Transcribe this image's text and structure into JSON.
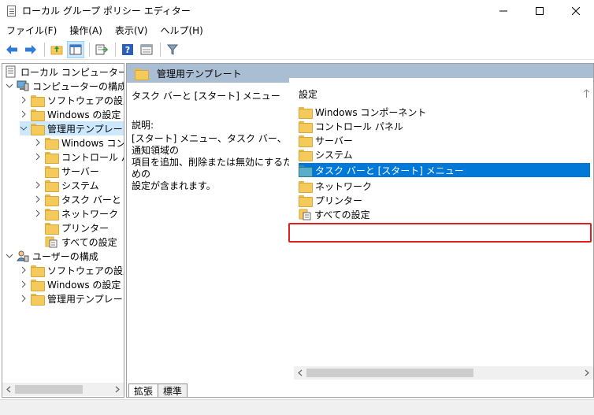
{
  "window": {
    "title": "ローカル グループ ポリシー エディター",
    "minimize_glyph": "—",
    "maximize_glyph": "☐",
    "close_glyph": "✕"
  },
  "menu": {
    "items": [
      "ファイル(F)",
      "操作(A)",
      "表示(V)",
      "ヘルプ(H)"
    ]
  },
  "toolbar": {
    "icons": [
      "back-arrow-icon",
      "forward-arrow-icon",
      "up-folder-icon",
      "show-hide-tree-icon",
      "export-list-icon",
      "help-icon",
      "properties-icon",
      "filter-icon"
    ]
  },
  "tree": {
    "items": [
      {
        "label": "ローカル コンピューター ポリシ",
        "level": 0,
        "icon": "policy-doc-icon"
      },
      {
        "label": "コンピューターの構成",
        "level": 1,
        "icon": "computer-icon",
        "expanded": true
      },
      {
        "label": "ソフトウェアの設定",
        "level": 2,
        "icon": "folder-icon",
        "collapsed": true
      },
      {
        "label": "Windows の設定",
        "level": 2,
        "icon": "folder-icon",
        "collapsed": true
      },
      {
        "label": "管理用テンプレート",
        "level": 2,
        "icon": "folder-icon",
        "expanded": true,
        "selected": true
      },
      {
        "label": "Windows コン",
        "level": 3,
        "icon": "folder-icon",
        "collapsed": true
      },
      {
        "label": "コントロール パネ",
        "level": 3,
        "icon": "folder-icon",
        "collapsed": true
      },
      {
        "label": "サーバー",
        "level": 3,
        "icon": "folder-icon"
      },
      {
        "label": "システム",
        "level": 3,
        "icon": "folder-icon",
        "collapsed": true
      },
      {
        "label": "タスク バーと [ス",
        "level": 3,
        "icon": "folder-icon",
        "collapsed": true
      },
      {
        "label": "ネットワーク",
        "level": 3,
        "icon": "folder-icon",
        "collapsed": true
      },
      {
        "label": "プリンター",
        "level": 3,
        "icon": "folder-icon"
      },
      {
        "label": "すべての設定",
        "level": 3,
        "icon": "all-settings-icon"
      },
      {
        "label": "ユーザーの構成",
        "level": 1,
        "icon": "user-icon",
        "expanded": true
      },
      {
        "label": "ソフトウェアの設定",
        "level": 2,
        "icon": "folder-icon",
        "collapsed": true
      },
      {
        "label": "Windows の設定",
        "level": 2,
        "icon": "folder-icon",
        "collapsed": true
      },
      {
        "label": "管理用テンプレート",
        "level": 2,
        "icon": "folder-icon",
        "collapsed": true
      }
    ]
  },
  "right": {
    "header_title": "管理用テンプレート",
    "description": {
      "title": "タスク バーと [スタート] メニュー",
      "label": "説明:",
      "lines": [
        "[スタート] メニュー、タスク バー、通知領域の",
        "項目を追加、削除または無効にするための",
        "設定が含まれます。"
      ]
    },
    "list": {
      "column_header": "設定",
      "items": [
        {
          "label": "Windows コンポーネント",
          "icon": "folder-icon"
        },
        {
          "label": "コントロール パネル",
          "icon": "folder-icon"
        },
        {
          "label": "サーバー",
          "icon": "folder-icon"
        },
        {
          "label": "システム",
          "icon": "folder-icon"
        },
        {
          "label": "タスク バーと [スタート] メニュー",
          "icon": "folder-open-icon",
          "selected": true
        },
        {
          "label": "ネットワーク",
          "icon": "folder-icon"
        },
        {
          "label": "プリンター",
          "icon": "folder-icon"
        },
        {
          "label": "すべての設定",
          "icon": "all-settings-icon"
        }
      ]
    },
    "tabs": [
      "拡張",
      "標準"
    ],
    "highlight_color": "#e02020",
    "selection_color": "#0078d7"
  }
}
